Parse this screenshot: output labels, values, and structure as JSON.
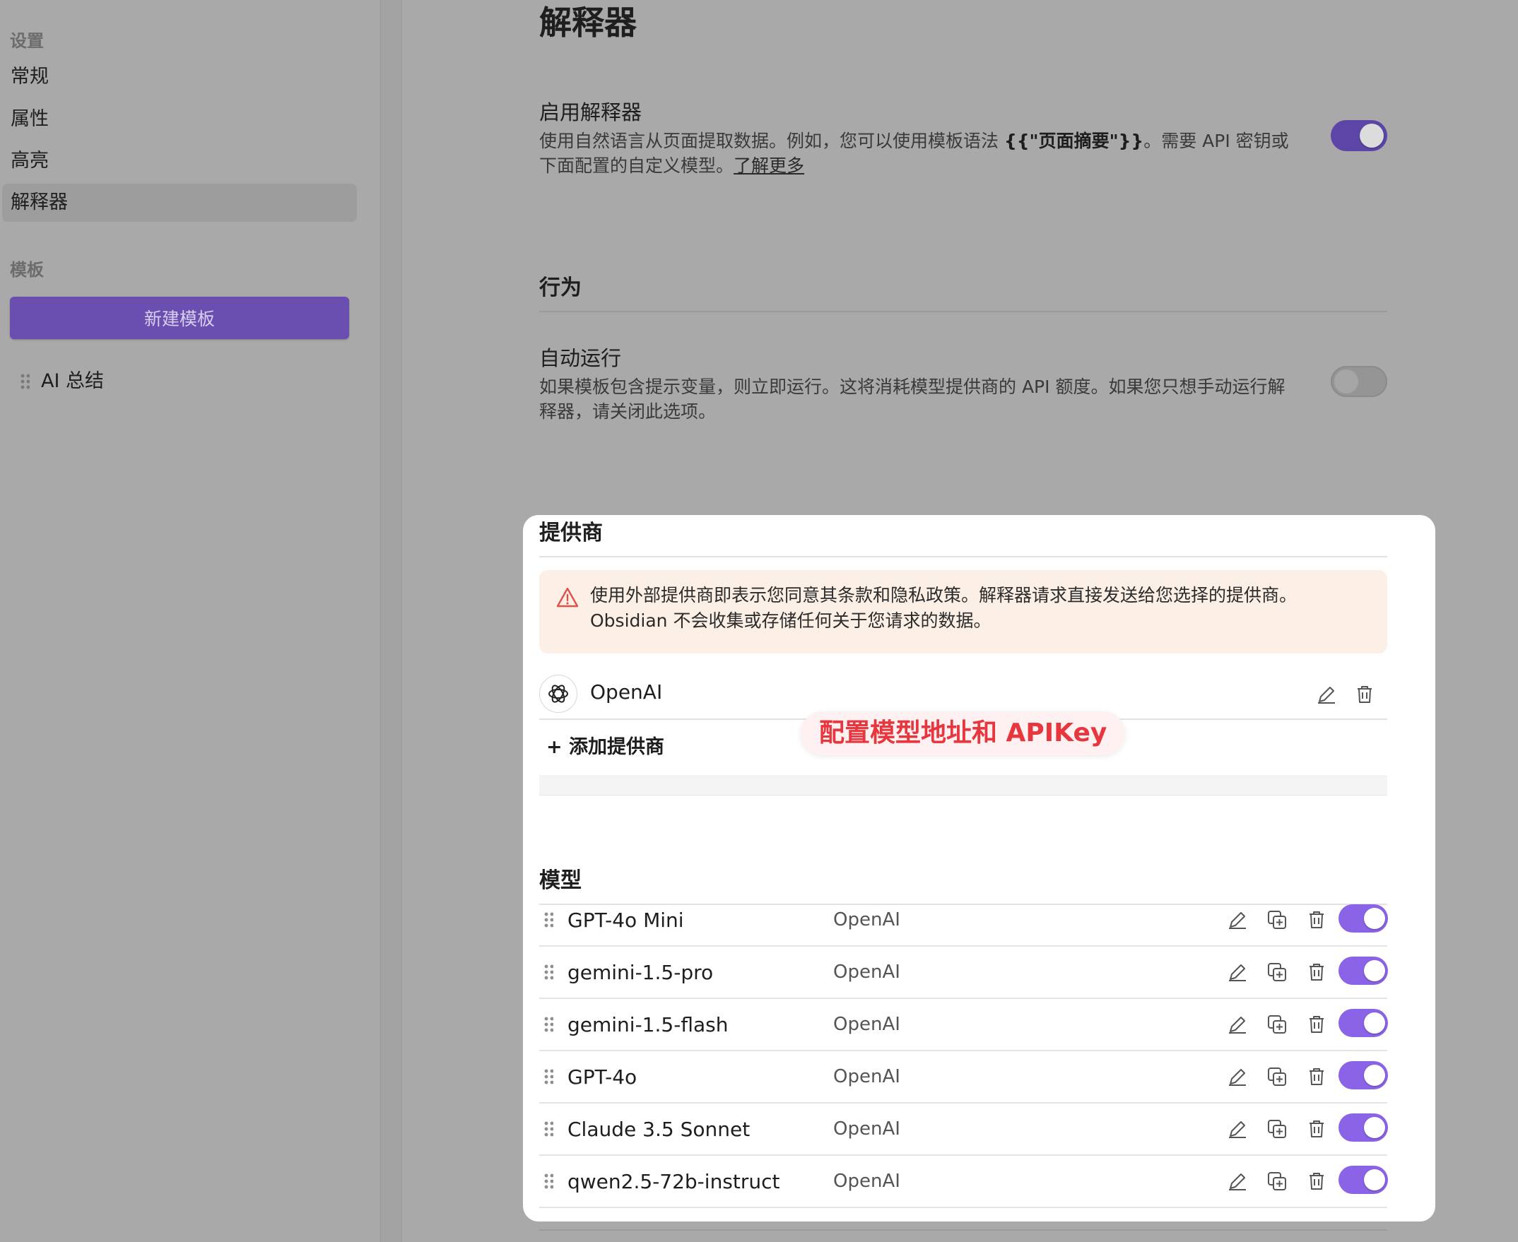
{
  "sidebar": {
    "settings_heading": "设置",
    "items": [
      {
        "label": "常规"
      },
      {
        "label": "属性"
      },
      {
        "label": "高亮"
      },
      {
        "label": "解释器"
      }
    ],
    "active_item": "解释器",
    "templates_heading": "模板",
    "new_template_label": "新建模板",
    "templates": [
      {
        "label": "AI 总结"
      }
    ]
  },
  "main": {
    "title": "解释器",
    "enable": {
      "name": "启用解释器",
      "desc_prefix": "使用自然语言从页面提取数据。例如，您可以使用模板语法 ",
      "desc_code": "{{\"页面摘要\"}}",
      "desc_suffix": "。需要 API 密钥或下面配置的自定义模型。",
      "learn_more": "了解更多",
      "enabled": true
    },
    "behavior": {
      "title": "行为",
      "auto_run_name": "自动运行",
      "auto_run_desc": "如果模板包含提示变量，则立即运行。这将消耗模型提供商的 API 额度。如果您只想手动运行解释器，请关闭此选项。",
      "auto_run_enabled": false
    },
    "providers": {
      "title": "提供商",
      "warning": "使用外部提供商即表示您同意其条款和隐私政策。解释器请求直接发送给您选择的提供商。Obsidian 不会收集或存储任何关于您请求的数据。",
      "list": [
        {
          "name": "OpenAI"
        }
      ],
      "add_label": "+ 添加提供商",
      "annotation": "配置模型地址和 APIKey"
    },
    "models": {
      "title": "模型",
      "list": [
        {
          "name": "GPT-4o Mini",
          "provider": "OpenAI",
          "enabled": true
        },
        {
          "name": "gemini-1.5-pro",
          "provider": "OpenAI",
          "enabled": true
        },
        {
          "name": "gemini-1.5-flash",
          "provider": "OpenAI",
          "enabled": true
        },
        {
          "name": "GPT-4o",
          "provider": "OpenAI",
          "enabled": true
        },
        {
          "name": "Claude 3.5 Sonnet",
          "provider": "OpenAI",
          "enabled": true
        },
        {
          "name": "qwen2.5-72b-instruct",
          "provider": "OpenAI",
          "enabled": true
        }
      ]
    }
  },
  "colors": {
    "accent": "#8a63e6",
    "accent_dimmed": "#5c45a6",
    "annotation_text": "#e8363f",
    "warning_bg": "#fcefe6",
    "warning_icon": "#e0514a"
  },
  "icons": [
    "drag-handle-icon",
    "warning-triangle-icon",
    "openai-logo-icon",
    "edit-pencil-icon",
    "duplicate-icon",
    "trash-icon"
  ]
}
